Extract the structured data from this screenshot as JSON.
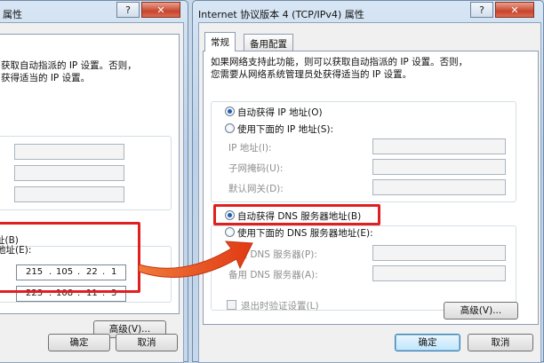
{
  "left_window": {
    "title": "属性",
    "help_glyph": "?",
    "description": "获取自动指派的 IP 设置。否则，\n获得适当的 IP 设置。",
    "dns_auto_label": "址(B)",
    "dns_manual_label": "地址(E):",
    "dns_preferred": [
      "215",
      "105",
      "22",
      "1"
    ],
    "dns_alternate": [
      "223",
      "108",
      "11",
      "3"
    ],
    "advanced_button": "高级(V)...",
    "ok_button": "确定",
    "cancel_button": "取消"
  },
  "right_window": {
    "title": "Internet 协议版本 4 (TCP/IPv4) 属性",
    "help_glyph": "?",
    "close_glyph": "X",
    "tabs": [
      {
        "label": "常规",
        "active": true
      },
      {
        "label": "备用配置",
        "active": false
      }
    ],
    "description": "如果网络支持此功能，则可以获取自动指派的 IP 设置。否则，\n您需要从网络系统管理员处获得适当的 IP 设置。",
    "ip_auto_radio": "自动获得 IP 地址(O)",
    "ip_manual_radio": "使用下面的 IP 地址(S):",
    "ip_fields": [
      {
        "label": "IP 地址(I):"
      },
      {
        "label": "子网掩码(U):"
      },
      {
        "label": "默认网关(D):"
      }
    ],
    "dns_auto_radio": "自动获得 DNS 服务器地址(B)",
    "dns_manual_radio": "使用下面的 DNS 服务器地址(E):",
    "dns_fields": [
      {
        "label": "首选 DNS 服务器(P):"
      },
      {
        "label": "备用 DNS 服务器(A):"
      }
    ],
    "validate_checkbox": "退出时验证设置(L)",
    "advanced_button": "高级(V)...",
    "ok_button": "确定",
    "cancel_button": "取消"
  },
  "colors": {
    "highlight": "#e02020",
    "arrow": "#e34a1e",
    "window_frame": "#c6d8ec",
    "radio_selected": "#1d5fb8"
  }
}
